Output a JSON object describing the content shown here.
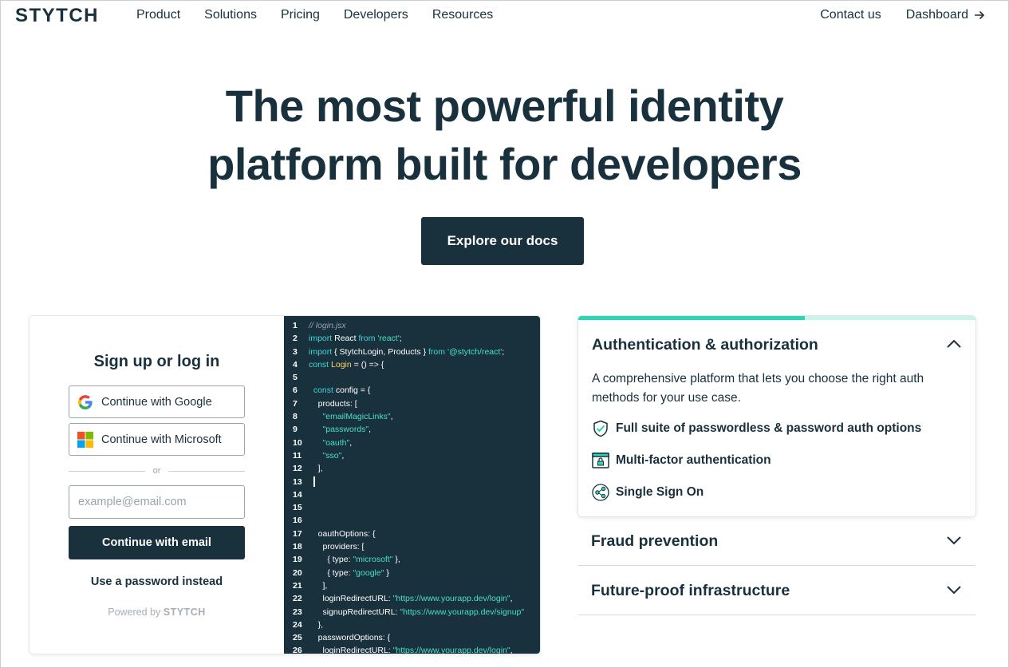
{
  "nav": {
    "logo": "STYTCH",
    "links": [
      "Product",
      "Solutions",
      "Pricing",
      "Developers",
      "Resources"
    ],
    "contact": "Contact us",
    "dashboard": "Dashboard"
  },
  "hero": {
    "title_line1": "The most powerful identity",
    "title_line2": "platform built for developers",
    "cta": "Explore our docs"
  },
  "login": {
    "title": "Sign up or log in",
    "google": "Continue with Google",
    "microsoft": "Continue with Microsoft",
    "divider": "or",
    "email_placeholder": "example@email.com",
    "email_button": "Continue with email",
    "password_link": "Use a password instead",
    "powered_prefix": "Powered by",
    "powered_brand": "STYTCH"
  },
  "code": {
    "line_numbers": [
      "1",
      "2",
      "3",
      "4",
      "5",
      "6",
      "7",
      "8",
      "9",
      "10",
      "11",
      "12",
      "13",
      "14",
      "15",
      "16",
      "17",
      "18",
      "19",
      "20",
      "21",
      "22",
      "23",
      "24",
      "25",
      "26"
    ]
  },
  "accordion": {
    "progress": 0.57,
    "open": {
      "title": "Authentication & authorization",
      "description": "A comprehensive platform that lets you choose the right auth methods for your use case.",
      "features": [
        "Full suite of passwordless & password auth options",
        "Multi-factor authentication",
        "Single Sign On"
      ]
    },
    "collapsed": [
      "Fraud prevention",
      "Future-proof infrastructure"
    ]
  },
  "colors": {
    "primary": "#19303d",
    "accent": "#2ad6b4",
    "code_keyword": "#3fd8d6",
    "code_string": "#48e0c6"
  }
}
